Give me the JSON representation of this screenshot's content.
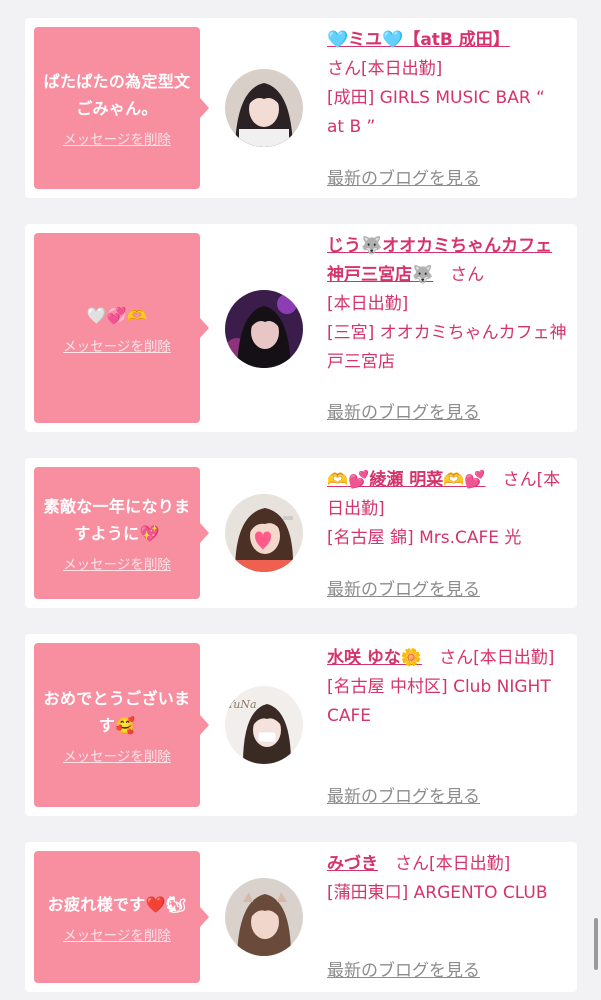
{
  "items": [
    {
      "message": "ぱたぱたの為定型文ごみゃん。",
      "delete_label": "メッセージを削除",
      "name": "🩵ミユ🩵【atB 成田】",
      "san": "さん",
      "status": "[本日出勤]",
      "area": "[成田]",
      "shop": "GIRLS MUSIC BAR “ at B ”",
      "blog_label": "最新のブログを見る"
    },
    {
      "message": "🤍💞🫶",
      "delete_label": "メッセージを削除",
      "name": "じう🐺オオカミちゃんカフェ神戸三宮店🐺",
      "san": "さん",
      "status": "[本日出勤]",
      "area": "[三宮]",
      "shop": "オオカミちゃんカフェ神戸三宮店",
      "blog_label": "最新のブログを見る"
    },
    {
      "message": "素敵な一年になりますように💖",
      "delete_label": "メッセージを削除",
      "name": "🫶💕綾瀬 明菜🫶💕",
      "san": "さん",
      "status": "[本日出勤]",
      "area": "[名古屋 錦]",
      "shop": "Mrs.CAFE 光",
      "blog_label": "最新のブログを見る"
    },
    {
      "message": "おめでとうございます🥰",
      "delete_label": "メッセージを削除",
      "name": "水咲 ゆな🌼",
      "san": "さん",
      "status": "[本日出勤]",
      "area": "[名古屋 中村区]",
      "shop": "Club NIGHT CAFE",
      "blog_label": "最新のブログを見る",
      "avatar_text": "YuNa"
    },
    {
      "message": "お疲れ様です❤️🐿",
      "delete_label": "メッセージを削除",
      "name": "みづき",
      "san": "さん",
      "status": "[本日出勤]",
      "area": "[蒲田東口]",
      "shop": "ARGENTO CLUB",
      "blog_label": "最新のブログを見る"
    }
  ],
  "colors": {
    "bubble": "#f78fa0",
    "accent_text": "#d6336c",
    "link_gray": "#8c8c8c",
    "background": "#f2f2f4"
  }
}
